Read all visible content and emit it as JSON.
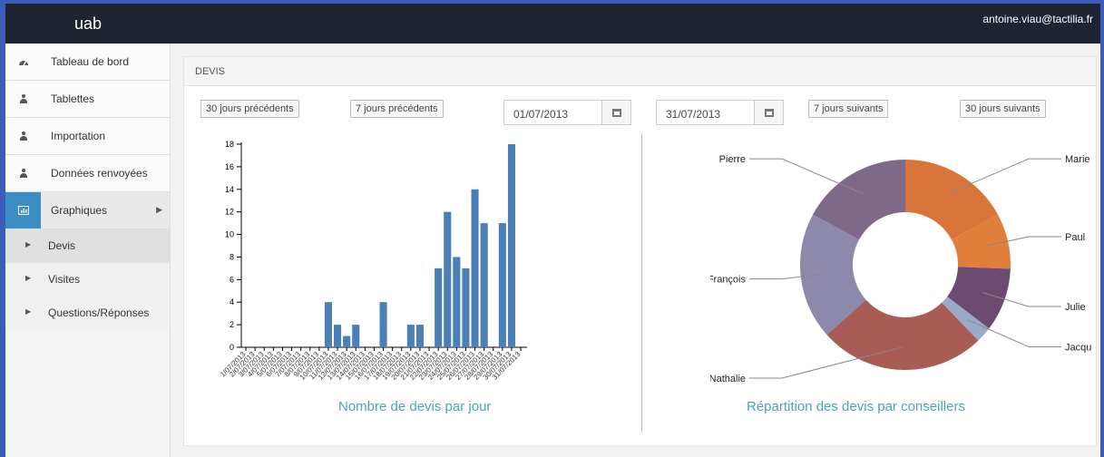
{
  "header": {
    "brand": "uab",
    "user_email": "antoine.viau@tactilia.fr"
  },
  "sidebar": {
    "items": [
      {
        "label": "Tableau de bord",
        "icon": "dashboard-icon"
      },
      {
        "label": "Tablettes",
        "icon": "user-icon"
      },
      {
        "label": "Importation",
        "icon": "user-icon"
      },
      {
        "label": "Données renvoyées",
        "icon": "user-icon"
      },
      {
        "label": "Graphiques",
        "icon": "bar-chart-icon"
      }
    ],
    "subitems": [
      {
        "label": "Devis"
      },
      {
        "label": "Visites"
      },
      {
        "label": "Questions/Réponses"
      }
    ]
  },
  "panel": {
    "title": "DEVIS"
  },
  "toolbar": {
    "prev30": "30 jours précédents",
    "prev7": "7 jours précédents",
    "start_date": "01/07/2013",
    "end_date": "31/07/2013",
    "next7": "7 jours suivants",
    "next30": "30 jours suivants"
  },
  "colors": {
    "bar": "#4a7fb8",
    "accent": "#3c8dc4",
    "title": "#4aa3bd"
  },
  "chart_data": [
    {
      "type": "bar",
      "title": "Nombre de devis par jour",
      "categories": [
        "1/07/2013",
        "2/07/2013",
        "3/07/2013",
        "4/07/2013",
        "5/07/2013",
        "6/07/2013",
        "7/07/2013",
        "8/07/2013",
        "9/07/2013",
        "10/07/2013",
        "11/07/2013",
        "12/07/2013",
        "13/07/2013",
        "14/07/2013",
        "15/07/2013",
        "16/07/2013",
        "17/07/2013",
        "18/07/2013",
        "19/07/2013",
        "20/07/2013",
        "21/07/2013",
        "22/07/2013",
        "23/07/2013",
        "24/07/2013",
        "25/07/2013",
        "26/07/2013",
        "27/07/2013",
        "28/07/2013",
        "29/07/2013",
        "30/07/2013",
        "31/07/2013"
      ],
      "values": [
        0,
        0,
        0,
        0,
        0,
        0,
        0,
        0,
        0,
        4,
        2,
        1,
        2,
        0,
        0,
        4,
        0,
        0,
        2,
        2,
        0,
        7,
        12,
        8,
        7,
        14,
        11,
        0,
        11,
        18,
        0
      ],
      "ylim": [
        0,
        18
      ],
      "yticks": [
        0,
        2,
        4,
        6,
        8,
        10,
        12,
        14,
        16,
        18
      ]
    },
    {
      "type": "pie",
      "title": "Répartition des devis par conseillers",
      "labels": [
        "Marie",
        "Paul",
        "Julie",
        "Jacques",
        "Nathalie",
        "François",
        "Pierre"
      ],
      "values": [
        14,
        7,
        8,
        2,
        21,
        16,
        14
      ],
      "colors": [
        "#d9743a",
        "#e07f3c",
        "#6d4b71",
        "#99abc7",
        "#a95c56",
        "#8d89aa",
        "#7d6988"
      ],
      "donut": true
    }
  ]
}
